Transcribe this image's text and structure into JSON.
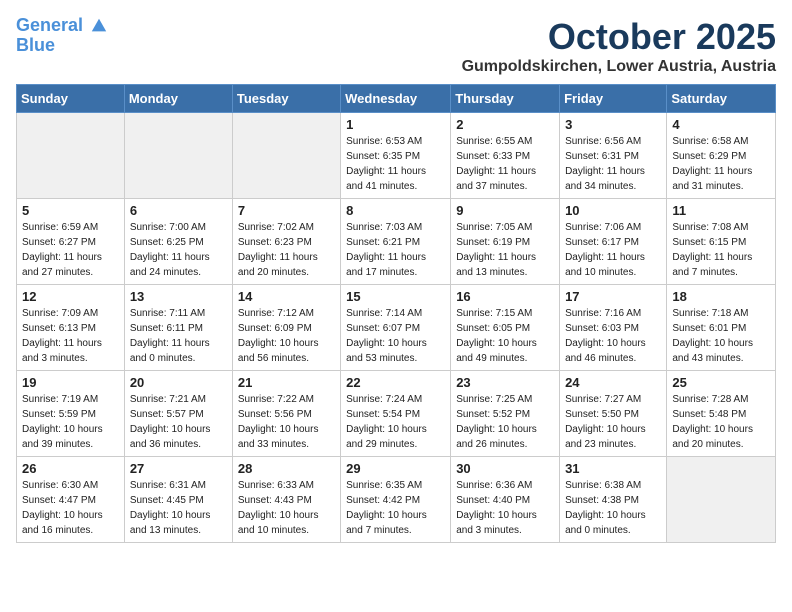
{
  "logo": {
    "line1": "General",
    "line2": "Blue"
  },
  "title": "October 2025",
  "location": "Gumpoldskirchen, Lower Austria, Austria",
  "days_of_week": [
    "Sunday",
    "Monday",
    "Tuesday",
    "Wednesday",
    "Thursday",
    "Friday",
    "Saturday"
  ],
  "weeks": [
    [
      {
        "day": "",
        "info": ""
      },
      {
        "day": "",
        "info": ""
      },
      {
        "day": "",
        "info": ""
      },
      {
        "day": "1",
        "info": "Sunrise: 6:53 AM\nSunset: 6:35 PM\nDaylight: 11 hours\nand 41 minutes."
      },
      {
        "day": "2",
        "info": "Sunrise: 6:55 AM\nSunset: 6:33 PM\nDaylight: 11 hours\nand 37 minutes."
      },
      {
        "day": "3",
        "info": "Sunrise: 6:56 AM\nSunset: 6:31 PM\nDaylight: 11 hours\nand 34 minutes."
      },
      {
        "day": "4",
        "info": "Sunrise: 6:58 AM\nSunset: 6:29 PM\nDaylight: 11 hours\nand 31 minutes."
      }
    ],
    [
      {
        "day": "5",
        "info": "Sunrise: 6:59 AM\nSunset: 6:27 PM\nDaylight: 11 hours\nand 27 minutes."
      },
      {
        "day": "6",
        "info": "Sunrise: 7:00 AM\nSunset: 6:25 PM\nDaylight: 11 hours\nand 24 minutes."
      },
      {
        "day": "7",
        "info": "Sunrise: 7:02 AM\nSunset: 6:23 PM\nDaylight: 11 hours\nand 20 minutes."
      },
      {
        "day": "8",
        "info": "Sunrise: 7:03 AM\nSunset: 6:21 PM\nDaylight: 11 hours\nand 17 minutes."
      },
      {
        "day": "9",
        "info": "Sunrise: 7:05 AM\nSunset: 6:19 PM\nDaylight: 11 hours\nand 13 minutes."
      },
      {
        "day": "10",
        "info": "Sunrise: 7:06 AM\nSunset: 6:17 PM\nDaylight: 11 hours\nand 10 minutes."
      },
      {
        "day": "11",
        "info": "Sunrise: 7:08 AM\nSunset: 6:15 PM\nDaylight: 11 hours\nand 7 minutes."
      }
    ],
    [
      {
        "day": "12",
        "info": "Sunrise: 7:09 AM\nSunset: 6:13 PM\nDaylight: 11 hours\nand 3 minutes."
      },
      {
        "day": "13",
        "info": "Sunrise: 7:11 AM\nSunset: 6:11 PM\nDaylight: 11 hours\nand 0 minutes."
      },
      {
        "day": "14",
        "info": "Sunrise: 7:12 AM\nSunset: 6:09 PM\nDaylight: 10 hours\nand 56 minutes."
      },
      {
        "day": "15",
        "info": "Sunrise: 7:14 AM\nSunset: 6:07 PM\nDaylight: 10 hours\nand 53 minutes."
      },
      {
        "day": "16",
        "info": "Sunrise: 7:15 AM\nSunset: 6:05 PM\nDaylight: 10 hours\nand 49 minutes."
      },
      {
        "day": "17",
        "info": "Sunrise: 7:16 AM\nSunset: 6:03 PM\nDaylight: 10 hours\nand 46 minutes."
      },
      {
        "day": "18",
        "info": "Sunrise: 7:18 AM\nSunset: 6:01 PM\nDaylight: 10 hours\nand 43 minutes."
      }
    ],
    [
      {
        "day": "19",
        "info": "Sunrise: 7:19 AM\nSunset: 5:59 PM\nDaylight: 10 hours\nand 39 minutes."
      },
      {
        "day": "20",
        "info": "Sunrise: 7:21 AM\nSunset: 5:57 PM\nDaylight: 10 hours\nand 36 minutes."
      },
      {
        "day": "21",
        "info": "Sunrise: 7:22 AM\nSunset: 5:56 PM\nDaylight: 10 hours\nand 33 minutes."
      },
      {
        "day": "22",
        "info": "Sunrise: 7:24 AM\nSunset: 5:54 PM\nDaylight: 10 hours\nand 29 minutes."
      },
      {
        "day": "23",
        "info": "Sunrise: 7:25 AM\nSunset: 5:52 PM\nDaylight: 10 hours\nand 26 minutes."
      },
      {
        "day": "24",
        "info": "Sunrise: 7:27 AM\nSunset: 5:50 PM\nDaylight: 10 hours\nand 23 minutes."
      },
      {
        "day": "25",
        "info": "Sunrise: 7:28 AM\nSunset: 5:48 PM\nDaylight: 10 hours\nand 20 minutes."
      }
    ],
    [
      {
        "day": "26",
        "info": "Sunrise: 6:30 AM\nSunset: 4:47 PM\nDaylight: 10 hours\nand 16 minutes."
      },
      {
        "day": "27",
        "info": "Sunrise: 6:31 AM\nSunset: 4:45 PM\nDaylight: 10 hours\nand 13 minutes."
      },
      {
        "day": "28",
        "info": "Sunrise: 6:33 AM\nSunset: 4:43 PM\nDaylight: 10 hours\nand 10 minutes."
      },
      {
        "day": "29",
        "info": "Sunrise: 6:35 AM\nSunset: 4:42 PM\nDaylight: 10 hours\nand 7 minutes."
      },
      {
        "day": "30",
        "info": "Sunrise: 6:36 AM\nSunset: 4:40 PM\nDaylight: 10 hours\nand 3 minutes."
      },
      {
        "day": "31",
        "info": "Sunrise: 6:38 AM\nSunset: 4:38 PM\nDaylight: 10 hours\nand 0 minutes."
      },
      {
        "day": "",
        "info": ""
      }
    ]
  ]
}
